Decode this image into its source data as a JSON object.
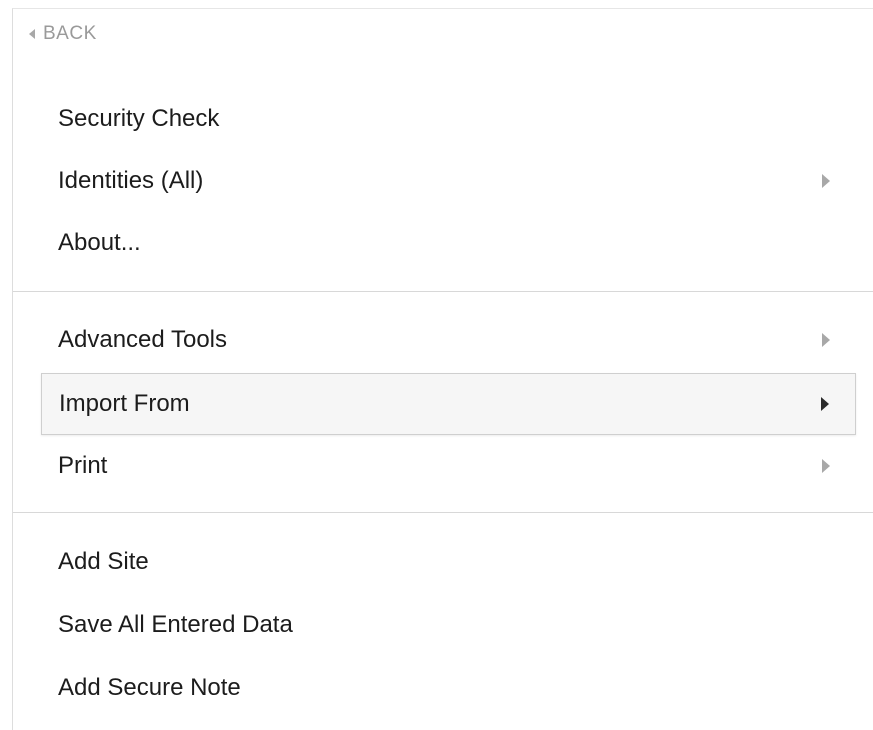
{
  "back": {
    "label": "BACK",
    "icon": "back-arrow-icon"
  },
  "groups": [
    {
      "items": [
        {
          "label": "Security Check",
          "has_submenu": false
        },
        {
          "label": "Identities (All)",
          "has_submenu": true
        },
        {
          "label": "About...",
          "has_submenu": false
        }
      ]
    },
    {
      "items": [
        {
          "label": "Advanced Tools",
          "has_submenu": true
        },
        {
          "label": "Import From",
          "has_submenu": true,
          "highlighted": true
        },
        {
          "label": "Print",
          "has_submenu": true
        }
      ]
    },
    {
      "items": [
        {
          "label": "Add Site",
          "has_submenu": false
        },
        {
          "label": "Save All Entered Data",
          "has_submenu": false
        },
        {
          "label": "Add Secure Note",
          "has_submenu": false
        }
      ]
    }
  ],
  "colors": {
    "text": "#1c1c1c",
    "muted": "#9a9a9a",
    "divider": "#d8d8d8",
    "highlight_bg": "#f6f6f6"
  }
}
